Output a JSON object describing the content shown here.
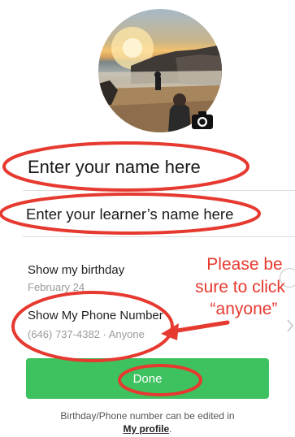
{
  "profile": {
    "photo_alt": "",
    "camera_icon": "camera-icon"
  },
  "fields": {
    "name_value": "Enter your name here",
    "learner_value": "Enter your learner’s name here"
  },
  "birthday": {
    "label": "Show my birthday",
    "value": "February 24"
  },
  "phone": {
    "label": "Show My Phone Number",
    "value": "(646) 737-4382 · Anyone"
  },
  "done_label": "Done",
  "footnote": {
    "line1": "Birthday/Phone number can be edited in",
    "link": "My profile",
    "end": "."
  },
  "annotation": {
    "line1": "Please be",
    "line2": "sure to click",
    "line3": "“anyone”"
  },
  "colors": {
    "accent_green": "#3ec25f",
    "annotation_red": "#e6392f"
  }
}
